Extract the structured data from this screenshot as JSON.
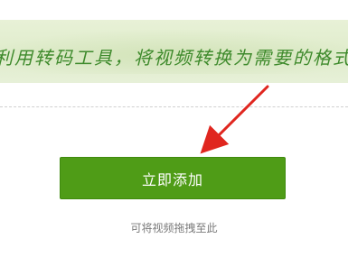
{
  "banner": {
    "text": "利用转码工具，将视频转换为需要的格式"
  },
  "upload": {
    "add_button_label": "立即添加",
    "drop_hint": "可将视频拖拽至此"
  },
  "colors": {
    "button_bg": "#4f9c17",
    "banner_text": "#3e8a2c",
    "arrow": "#e0261f"
  }
}
